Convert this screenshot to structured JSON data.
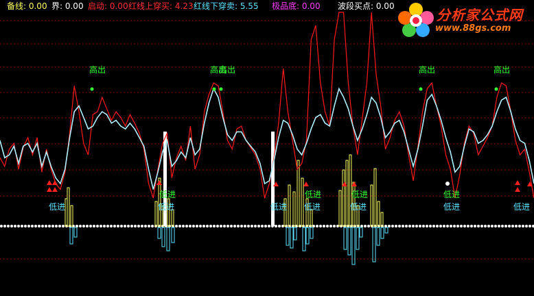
{
  "header": {
    "items": [
      {
        "text": "备线: 0.00",
        "color": "#ffff66"
      },
      {
        "text": "界: 0.00",
        "color": "#ffffff"
      },
      {
        "text": "启动: 0.00",
        "color": "#ff3030"
      },
      {
        "text": "红线上穿买: 4.23",
        "color": "#ff3030"
      },
      {
        "text": "红线下穿卖: 5.55",
        "color": "#5fe3ff"
      },
      {
        "text": "极品底: 0.00",
        "color": "#ff40ff"
      },
      {
        "text": "波段买点: 0.00",
        "color": "#ffffff"
      }
    ]
  },
  "logo": {
    "title": "分析家公式网",
    "url": "www.88gs.com"
  },
  "chart_data": {
    "type": "line",
    "title": "",
    "ylim": [
      0,
      100
    ],
    "series": [
      {
        "color": "#ff1a1a",
        "values": [
          38,
          32,
          44,
          48,
          30,
          45,
          52,
          40,
          52,
          28,
          44,
          30,
          20,
          16,
          28,
          55,
          88,
          70,
          48,
          40,
          68,
          70,
          80,
          72,
          64,
          70,
          66,
          60,
          68,
          62,
          55,
          44,
          20,
          10,
          30,
          48,
          55,
          24,
          38,
          46,
          36,
          60,
          30,
          40,
          70,
          82,
          90,
          88,
          70,
          50,
          44,
          58,
          60,
          50,
          45,
          40,
          30,
          10,
          20,
          38,
          62,
          100,
          70,
          50,
          30,
          34,
          50,
          120,
          130,
          90,
          70,
          60,
          120,
          178,
          150,
          90,
          60,
          40,
          65,
          90,
          140,
          96,
          74,
          44,
          52,
          64,
          70,
          60,
          40,
          22,
          46,
          70,
          86,
          90,
          74,
          60,
          40,
          30,
          10,
          26,
          48,
          60,
          55,
          40,
          46,
          52,
          60,
          80,
          90,
          88,
          70,
          50,
          40,
          44,
          28,
          10
        ]
      },
      {
        "color": "#b0f0ff",
        "values": [
          50,
          38,
          40,
          46,
          34,
          46,
          48,
          42,
          48,
          32,
          42,
          32,
          24,
          20,
          30,
          52,
          70,
          74,
          66,
          58,
          60,
          66,
          70,
          68,
          62,
          64,
          60,
          58,
          62,
          58,
          52,
          46,
          30,
          16,
          28,
          42,
          50,
          32,
          36,
          42,
          38,
          52,
          40,
          44,
          62,
          76,
          86,
          80,
          66,
          54,
          50,
          56,
          56,
          50,
          46,
          42,
          34,
          20,
          22,
          36,
          52,
          64,
          62,
          54,
          44,
          40,
          48,
          58,
          66,
          68,
          62,
          60,
          74,
          86,
          80,
          72,
          60,
          50,
          58,
          68,
          80,
          76,
          66,
          52,
          56,
          62,
          64,
          56,
          44,
          32,
          44,
          60,
          78,
          82,
          74,
          64,
          52,
          42,
          28,
          32,
          46,
          58,
          56,
          48,
          50,
          54,
          60,
          70,
          78,
          80,
          70,
          58,
          50,
          48,
          36,
          20
        ]
      }
    ],
    "markers": {
      "high": [
        "高出",
        "高出",
        "高出",
        "高出",
        "高出",
        "高出"
      ],
      "low": [
        "低进",
        "低进",
        "低进",
        "低进",
        "低进",
        "低进",
        "低进",
        "低进",
        "低进",
        "低进",
        "低进"
      ]
    }
  }
}
